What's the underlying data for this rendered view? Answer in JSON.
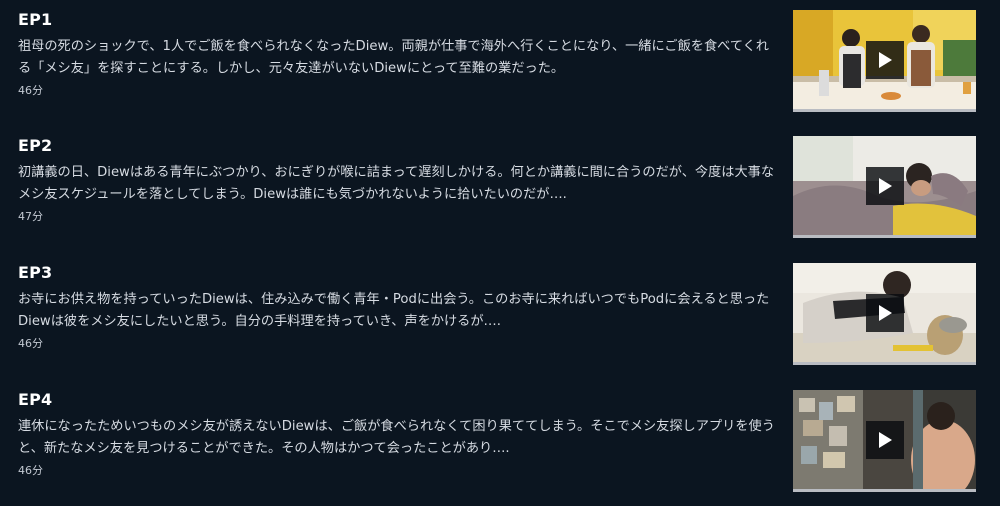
{
  "episodes": [
    {
      "title": "EP1",
      "description": "祖母の死のショックで、1人でご飯を食べられなくなったDiew。両親が仕事で海外へ行くことになり、一緒にご飯を食べてくれる「メシ友」を探すことにする。しかし、元々友達がいないDiewにとって至難の業だった。",
      "duration": "46分",
      "thumbnail_icon": "play-icon"
    },
    {
      "title": "EP2",
      "description": "初講義の日、Diewはある青年にぶつかり、おにぎりが喉に詰まって遅刻しかける。何とか講義に間に合うのだが、今度は大事なメシ友スケジュールを落としてしまう。Diewは誰にも気づかれないように拾いたいのだが….",
      "duration": "47分",
      "thumbnail_icon": "play-icon"
    },
    {
      "title": "EP3",
      "description": "お寺にお供え物を持っていったDiewは、住み込みで働く青年・Podに出会う。このお寺に来ればいつでもPodに会えると思ったDiewは彼をメシ友にしたいと思う。自分の手料理を持っていき、声をかけるが….",
      "duration": "46分",
      "thumbnail_icon": "play-icon"
    },
    {
      "title": "EP4",
      "description": "連休になったためいつものメシ友が誘えないDiewは、ご飯が食べられなくて困り果ててしまう。そこでメシ友探しアプリを使うと、新たなメシ友を見つけることができた。その人物はかつて会ったことがあり….",
      "duration": "46分",
      "thumbnail_icon": "play-icon"
    }
  ],
  "colors": {
    "background": "#0b1520",
    "title": "#ffffff",
    "text": "#d6dbe2",
    "progress_bar": "#b9bcc2"
  }
}
